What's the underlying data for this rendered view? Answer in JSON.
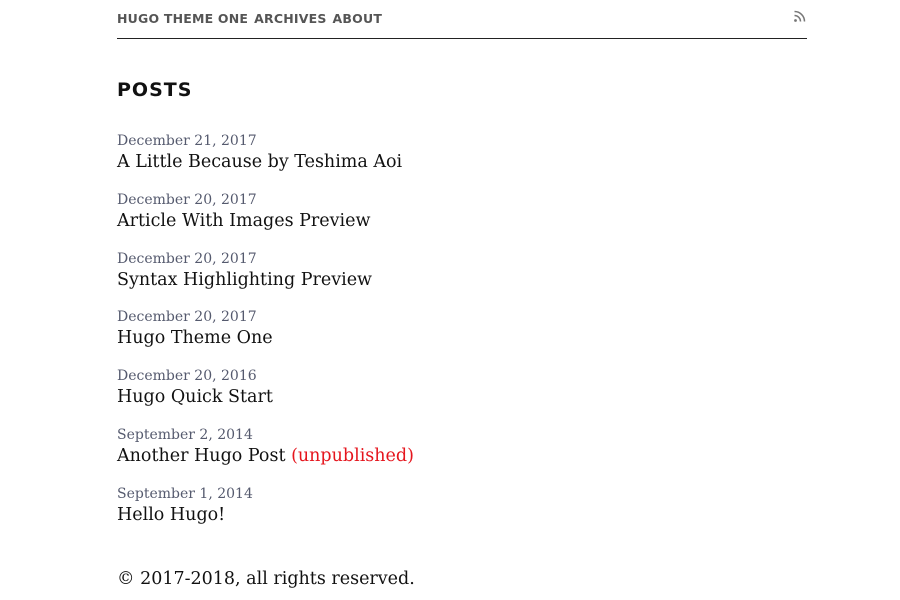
{
  "nav": {
    "site_title": "HUGO THEME ONE",
    "items": [
      "ARCHIVES",
      "ABOUT"
    ],
    "rss_icon": "rss-icon"
  },
  "section": {
    "title": "POSTS"
  },
  "posts": [
    {
      "date": "December 21, 2017",
      "title": "A Little Because by Teshima Aoi",
      "status": ""
    },
    {
      "date": "December 20, 2017",
      "title": "Article With Images Preview",
      "status": ""
    },
    {
      "date": "December 20, 2017",
      "title": "Syntax Highlighting Preview",
      "status": ""
    },
    {
      "date": "December 20, 2017",
      "title": "Hugo Theme One",
      "status": ""
    },
    {
      "date": "December 20, 2016",
      "title": "Hugo Quick Start",
      "status": ""
    },
    {
      "date": "September 2, 2014",
      "title": "Another Hugo Post",
      "status": "(unpublished)"
    },
    {
      "date": "September 1, 2014",
      "title": "Hello Hugo!",
      "status": ""
    }
  ],
  "footer": {
    "text": "© 2017-2018, all rights reserved."
  },
  "colors": {
    "unpublished": "#e5151d",
    "date": "#555a6e",
    "nav": "#555555"
  }
}
